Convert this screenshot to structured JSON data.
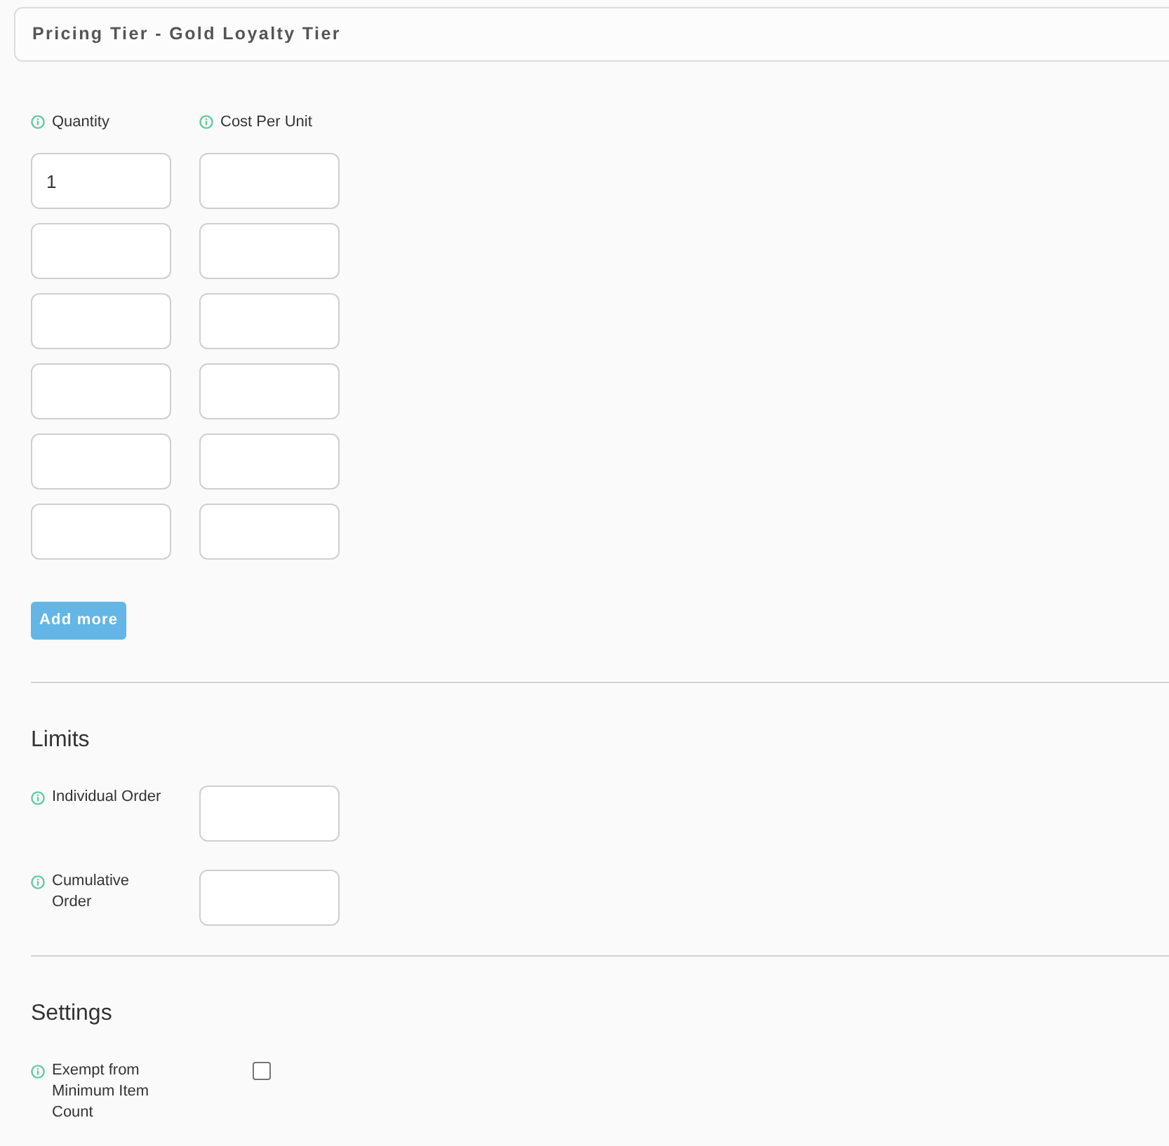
{
  "header": {
    "title": "Pricing Tier - Gold Loyalty Tier"
  },
  "pricing": {
    "columns": [
      {
        "label": "Quantity"
      },
      {
        "label": "Cost Per Unit"
      }
    ],
    "rows": [
      {
        "quantity": "1"
      },
      {},
      {},
      {},
      {},
      {}
    ],
    "add_button": {
      "label": "Add more"
    }
  },
  "limits": {
    "title": "Limits",
    "fields": [
      {
        "label": "Individual Order"
      },
      {
        "label": "Cumulative Order"
      }
    ]
  },
  "settings": {
    "title": "Settings",
    "fields": [
      {
        "label": "Exempt from Minimum Item Count",
        "checked": false
      }
    ]
  }
}
